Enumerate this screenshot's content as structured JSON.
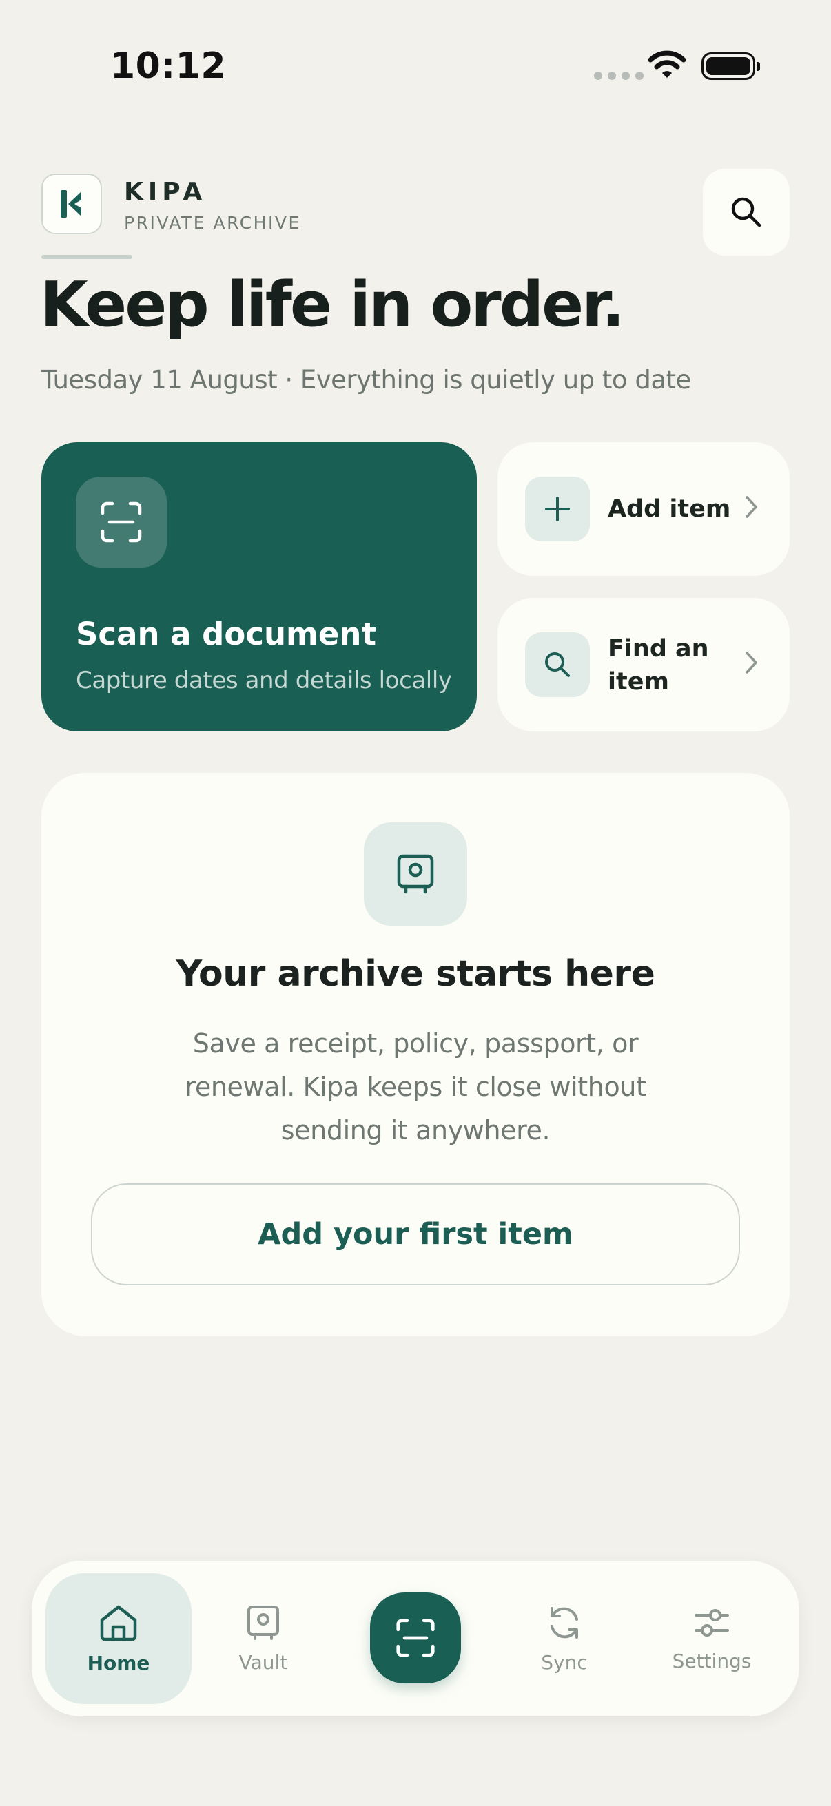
{
  "status_bar": {
    "time": "10:12"
  },
  "brand": {
    "name": "KIPA",
    "subtitle": "PRIVATE ARCHIVE"
  },
  "header": {
    "headline": "Keep life in order.",
    "subline": "Tuesday 11 August · Everything is quietly up to date"
  },
  "scan_card": {
    "title": "Scan a document",
    "subtitle": "Capture dates and details locally",
    "icon": "scan-icon"
  },
  "actions": [
    {
      "label": "Add item",
      "icon": "plus-icon"
    },
    {
      "label": "Find an item",
      "icon": "search-icon"
    }
  ],
  "empty_state": {
    "icon": "vault-icon",
    "title": "Your archive starts here",
    "text": "Save a receipt, policy, passport, or renewal. Kipa keeps it close without sending it anywhere.",
    "button_label": "Add your first item"
  },
  "nav": {
    "items": [
      {
        "label": "Home",
        "icon": "home-icon",
        "active": true
      },
      {
        "label": "Vault",
        "icon": "vault-icon",
        "active": false
      },
      {
        "label": "Sync",
        "icon": "sync-icon",
        "active": false
      },
      {
        "label": "Settings",
        "icon": "sliders-icon",
        "active": false
      }
    ],
    "center_icon": "scan-icon"
  },
  "colors": {
    "background": "#f3f1ec",
    "card": "#fdfdf8",
    "accent": "#1a5f54",
    "accent_soft": "#e1ebe7",
    "text": "#17201c",
    "muted": "#6f7773"
  }
}
